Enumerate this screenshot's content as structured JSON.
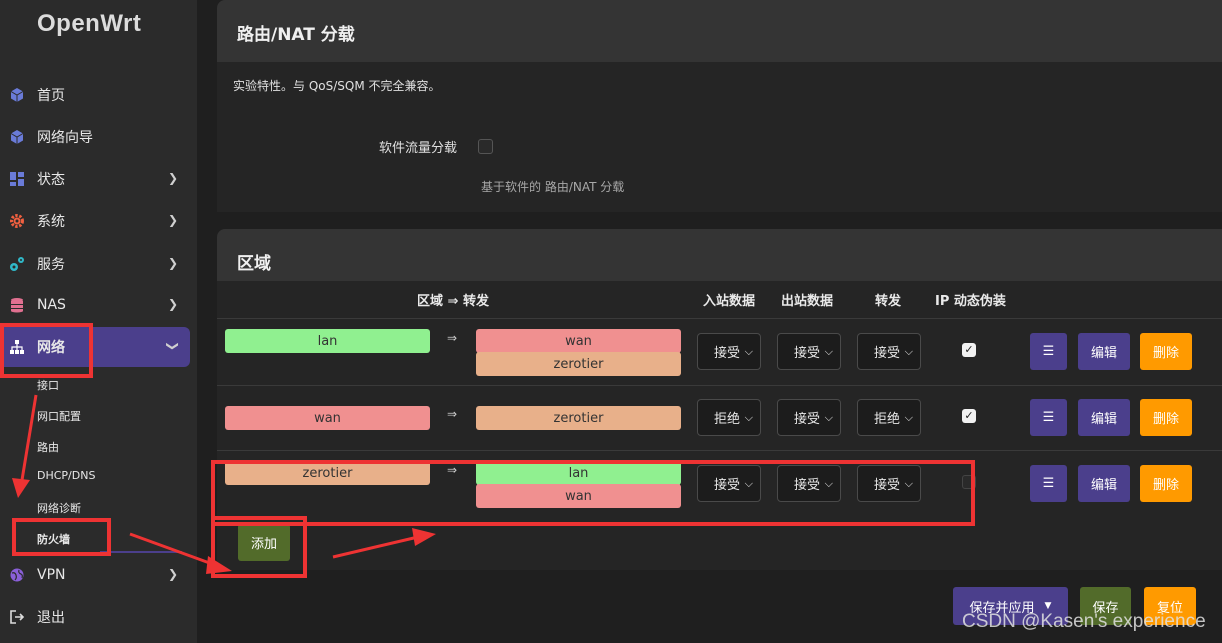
{
  "app": {
    "logo": "OpenWrt"
  },
  "sidebar": {
    "items": [
      {
        "label": "首页",
        "icon": "cube-icon",
        "has_chevron": false
      },
      {
        "label": "网络向导",
        "icon": "cube-icon",
        "has_chevron": false
      },
      {
        "label": "状态",
        "icon": "dashboard-icon",
        "has_chevron": true
      },
      {
        "label": "系统",
        "icon": "gear-icon",
        "has_chevron": true
      },
      {
        "label": "服务",
        "icon": "cogs-icon",
        "has_chevron": true
      },
      {
        "label": "NAS",
        "icon": "database-icon",
        "has_chevron": true
      },
      {
        "label": "网络",
        "icon": "sitemap-icon",
        "has_chevron": true,
        "expanded": true
      },
      {
        "label": "VPN",
        "icon": "globe-icon",
        "has_chevron": true
      },
      {
        "label": "退出",
        "icon": "logout-icon",
        "has_chevron": false
      }
    ],
    "network_sub": [
      "接口",
      "网口配置",
      "路由",
      "DHCP/DNS",
      "网络诊断",
      "防火墙"
    ]
  },
  "offload": {
    "title": "路由/NAT 分载",
    "description": "实验特性。与 QoS/SQM 不完全兼容。",
    "option_label": "软件流量分载",
    "option_checked": false,
    "option_hint": "基于软件的 路由/NAT 分载"
  },
  "zones": {
    "title": "区域",
    "headers": {
      "zone_forward": "区域 ⇒ 转发",
      "input": "入站数据",
      "output": "出站数据",
      "forward": "转发",
      "masq": "IP 动态伪装"
    },
    "arrow": "⇒",
    "rows": [
      {
        "zone": "lan",
        "targets": [
          "wan",
          "zerotier"
        ],
        "input": "接受",
        "output": "接受",
        "forward": "接受",
        "masq": true
      },
      {
        "zone": "wan",
        "targets": [
          "zerotier"
        ],
        "input": "拒绝",
        "output": "接受",
        "forward": "拒绝",
        "masq": true
      },
      {
        "zone": "zerotier",
        "targets": [
          "lan",
          "wan"
        ],
        "input": "接受",
        "output": "接受",
        "forward": "接受",
        "masq": false
      }
    ],
    "row_buttons": {
      "menu": "☰",
      "edit": "编辑",
      "delete": "删除"
    },
    "add_label": "添加"
  },
  "footer": {
    "save_apply": "保存并应用",
    "save": "保存",
    "reset": "复位"
  },
  "watermark": "CSDN @Kasen's experience",
  "colors": {
    "accent": "#4b3f8c",
    "orange": "#ff9a00",
    "green": "#526b2a",
    "zone_lan": "#90f090",
    "zone_wan": "#f09090",
    "zone_zerotier": "#e8b08a",
    "annotation": "#ee3333"
  }
}
